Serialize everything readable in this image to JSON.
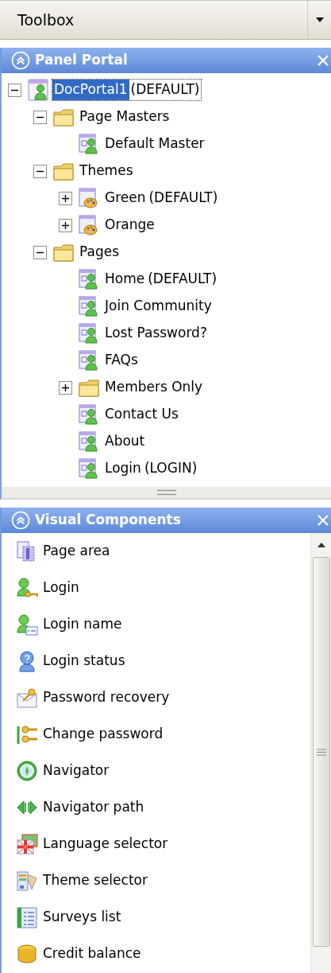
{
  "toolbox": {
    "title": "Toolbox"
  },
  "panels": [
    {
      "title": "Panel Portal",
      "tree": [
        {
          "kind": "portal",
          "label": "DocPortal1",
          "tag": "(DEFAULT)",
          "selected": true,
          "expanded": true,
          "children": [
            {
              "kind": "folder",
              "label": "Page Masters",
              "selected": false,
              "expanded": true,
              "children": [
                {
                  "kind": "master",
                  "label": "Default Master",
                  "selected": false
                }
              ]
            },
            {
              "kind": "folder",
              "label": "Themes",
              "selected": false,
              "expanded": true,
              "children": [
                {
                  "kind": "theme",
                  "label": "Green",
                  "tag": "(DEFAULT)",
                  "selected": false,
                  "expanded": false
                },
                {
                  "kind": "theme",
                  "label": "Orange",
                  "selected": false,
                  "expanded": false
                }
              ]
            },
            {
              "kind": "folder",
              "label": "Pages",
              "selected": false,
              "expanded": true,
              "children": [
                {
                  "kind": "page",
                  "label": "Home",
                  "tag": "(DEFAULT)",
                  "selected": false
                },
                {
                  "kind": "page",
                  "label": "Join Community",
                  "selected": false
                },
                {
                  "kind": "page",
                  "label": "Lost Password?",
                  "selected": false
                },
                {
                  "kind": "page",
                  "label": "FAQs",
                  "selected": false
                },
                {
                  "kind": "folder",
                  "label": "Members Only",
                  "selected": false,
                  "expanded": false
                },
                {
                  "kind": "page",
                  "label": "Contact Us",
                  "selected": false
                },
                {
                  "kind": "page",
                  "label": "About",
                  "selected": false
                },
                {
                  "kind": "page",
                  "label": "Login",
                  "tag": "(LOGIN)",
                  "selected": false
                }
              ]
            }
          ]
        }
      ]
    },
    {
      "title": "Visual Components",
      "items": [
        {
          "kind": "page-area",
          "label": "Page area"
        },
        {
          "kind": "login",
          "label": "Login"
        },
        {
          "kind": "login-name",
          "label": "Login name"
        },
        {
          "kind": "login-status",
          "label": "Login status"
        },
        {
          "kind": "password-recovery",
          "label": "Password recovery"
        },
        {
          "kind": "change-password",
          "label": "Change password"
        },
        {
          "kind": "navigator",
          "label": "Navigator"
        },
        {
          "kind": "navigator-path",
          "label": "Navigator path"
        },
        {
          "kind": "language",
          "label": "Language selector"
        },
        {
          "kind": "theme-selector",
          "label": "Theme selector"
        },
        {
          "kind": "surveys",
          "label": "Surveys list"
        },
        {
          "kind": "credit",
          "label": "Credit balance"
        }
      ]
    }
  ]
}
